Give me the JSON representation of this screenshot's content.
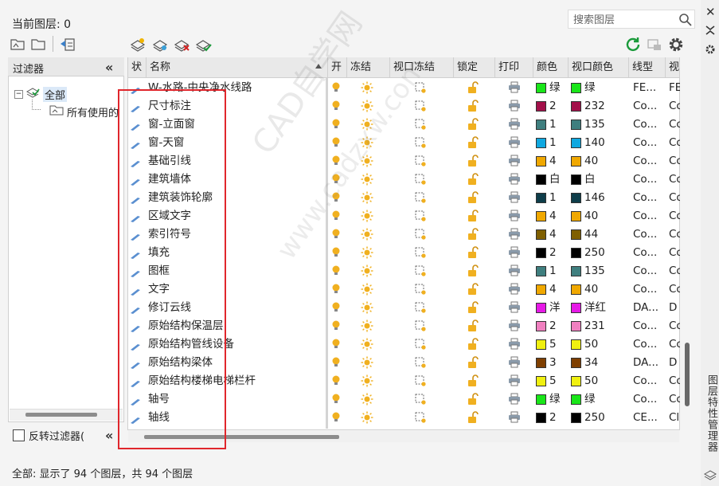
{
  "current_layer": "当前图层: 0",
  "search": {
    "placeholder": "搜索图层"
  },
  "filter_panel": {
    "title": "过滤器",
    "tree_root": "全部",
    "tree_child": "所有使用的",
    "invert_label": "反转过滤器("
  },
  "columns": [
    {
      "key": "status",
      "label": "状"
    },
    {
      "key": "name",
      "label": "名称"
    },
    {
      "key": "on",
      "label": "开"
    },
    {
      "key": "freeze",
      "label": "冻结"
    },
    {
      "key": "vp_freeze",
      "label": "视口冻结"
    },
    {
      "key": "lock",
      "label": "锁定"
    },
    {
      "key": "print",
      "label": "打印"
    },
    {
      "key": "color",
      "label": "颜色"
    },
    {
      "key": "vp_color",
      "label": "视口颜色"
    },
    {
      "key": "linetype",
      "label": "线型"
    },
    {
      "key": "vp_linetype",
      "label": "视"
    }
  ],
  "layers": [
    {
      "name": "W-水路-中央净水线路",
      "color_hex": "#19e619",
      "color_name": "绿",
      "vp_hex": "#19e619",
      "vp_name": "绿",
      "linetype": "FE...",
      "vp_linetype": "FE"
    },
    {
      "name": "尺寸标注",
      "color_hex": "#a3104a",
      "color_name": "2",
      "vp_hex": "#a3104a",
      "vp_name": "232",
      "linetype": "Co...",
      "vp_linetype": "Co"
    },
    {
      "name": "窗-立面窗",
      "color_hex": "#3f7f7f",
      "color_name": "1",
      "vp_hex": "#3f7f7f",
      "vp_name": "135",
      "linetype": "Co...",
      "vp_linetype": "Co"
    },
    {
      "name": "窗-天窗",
      "color_hex": "#10a8e0",
      "color_name": "1",
      "vp_hex": "#10a8e0",
      "vp_name": "140",
      "linetype": "Co...",
      "vp_linetype": "Co"
    },
    {
      "name": "基础引线",
      "color_hex": "#f0a800",
      "color_name": "4",
      "vp_hex": "#f0a800",
      "vp_name": "40",
      "linetype": "Co...",
      "vp_linetype": "Co"
    },
    {
      "name": "建筑墙体",
      "color_hex": "#000000",
      "color_name": "白",
      "vp_hex": "#000000",
      "vp_name": "白",
      "linetype": "Co...",
      "vp_linetype": "Co"
    },
    {
      "name": "建筑装饰轮廓",
      "color_hex": "#0e3d4a",
      "color_name": "1",
      "vp_hex": "#0e3d4a",
      "vp_name": "146",
      "linetype": "Co...",
      "vp_linetype": "Co"
    },
    {
      "name": "区域文字",
      "color_hex": "#f0a800",
      "color_name": "4",
      "vp_hex": "#f0a800",
      "vp_name": "40",
      "linetype": "Co...",
      "vp_linetype": "Co"
    },
    {
      "name": "索引符号",
      "color_hex": "#7f5f00",
      "color_name": "4",
      "vp_hex": "#7f5f00",
      "vp_name": "44",
      "linetype": "Co...",
      "vp_linetype": "Co"
    },
    {
      "name": "填充",
      "color_hex": "#000000",
      "color_name": "2",
      "vp_hex": "#000000",
      "vp_name": "250",
      "linetype": "Co...",
      "vp_linetype": "Co"
    },
    {
      "name": "图框",
      "color_hex": "#3f7f7f",
      "color_name": "1",
      "vp_hex": "#3f7f7f",
      "vp_name": "135",
      "linetype": "Co...",
      "vp_linetype": "Co"
    },
    {
      "name": "文字",
      "color_hex": "#f0a800",
      "color_name": "4",
      "vp_hex": "#f0a800",
      "vp_name": "40",
      "linetype": "Co...",
      "vp_linetype": "Co"
    },
    {
      "name": "修订云线",
      "color_hex": "#e619e6",
      "color_name": "洋",
      "vp_hex": "#e619e6",
      "vp_name": "洋红",
      "linetype": "DA...",
      "vp_linetype": "D"
    },
    {
      "name": "原始结构保温层",
      "color_hex": "#f080c0",
      "color_name": "2",
      "vp_hex": "#f080c0",
      "vp_name": "231",
      "linetype": "Co...",
      "vp_linetype": "Co"
    },
    {
      "name": "原始结构管线设备",
      "color_hex": "#f0f010",
      "color_name": "5",
      "vp_hex": "#f0f010",
      "vp_name": "50",
      "linetype": "Co...",
      "vp_linetype": "Co"
    },
    {
      "name": "原始结构梁体",
      "color_hex": "#7f3f00",
      "color_name": "3",
      "vp_hex": "#7f3f00",
      "vp_name": "34",
      "linetype": "DA...",
      "vp_linetype": "D"
    },
    {
      "name": "原始结构楼梯电梯栏杆",
      "color_hex": "#f0f010",
      "color_name": "5",
      "vp_hex": "#f0f010",
      "vp_name": "50",
      "linetype": "Co...",
      "vp_linetype": "Co"
    },
    {
      "name": "轴号",
      "color_hex": "#19e619",
      "color_name": "绿",
      "vp_hex": "#19e619",
      "vp_name": "绿",
      "linetype": "Co...",
      "vp_linetype": "Co"
    },
    {
      "name": "轴线",
      "color_hex": "#000000",
      "color_name": "2",
      "vp_hex": "#000000",
      "vp_name": "250",
      "linetype": "CE...",
      "vp_linetype": "Cl"
    }
  ],
  "status_text": "全部: 显示了 94 个图层，共 94 个图层",
  "side_title": "图层特性管理器",
  "watermark_1": "CAD自学网",
  "watermark_2": "www.cadzxw.com"
}
